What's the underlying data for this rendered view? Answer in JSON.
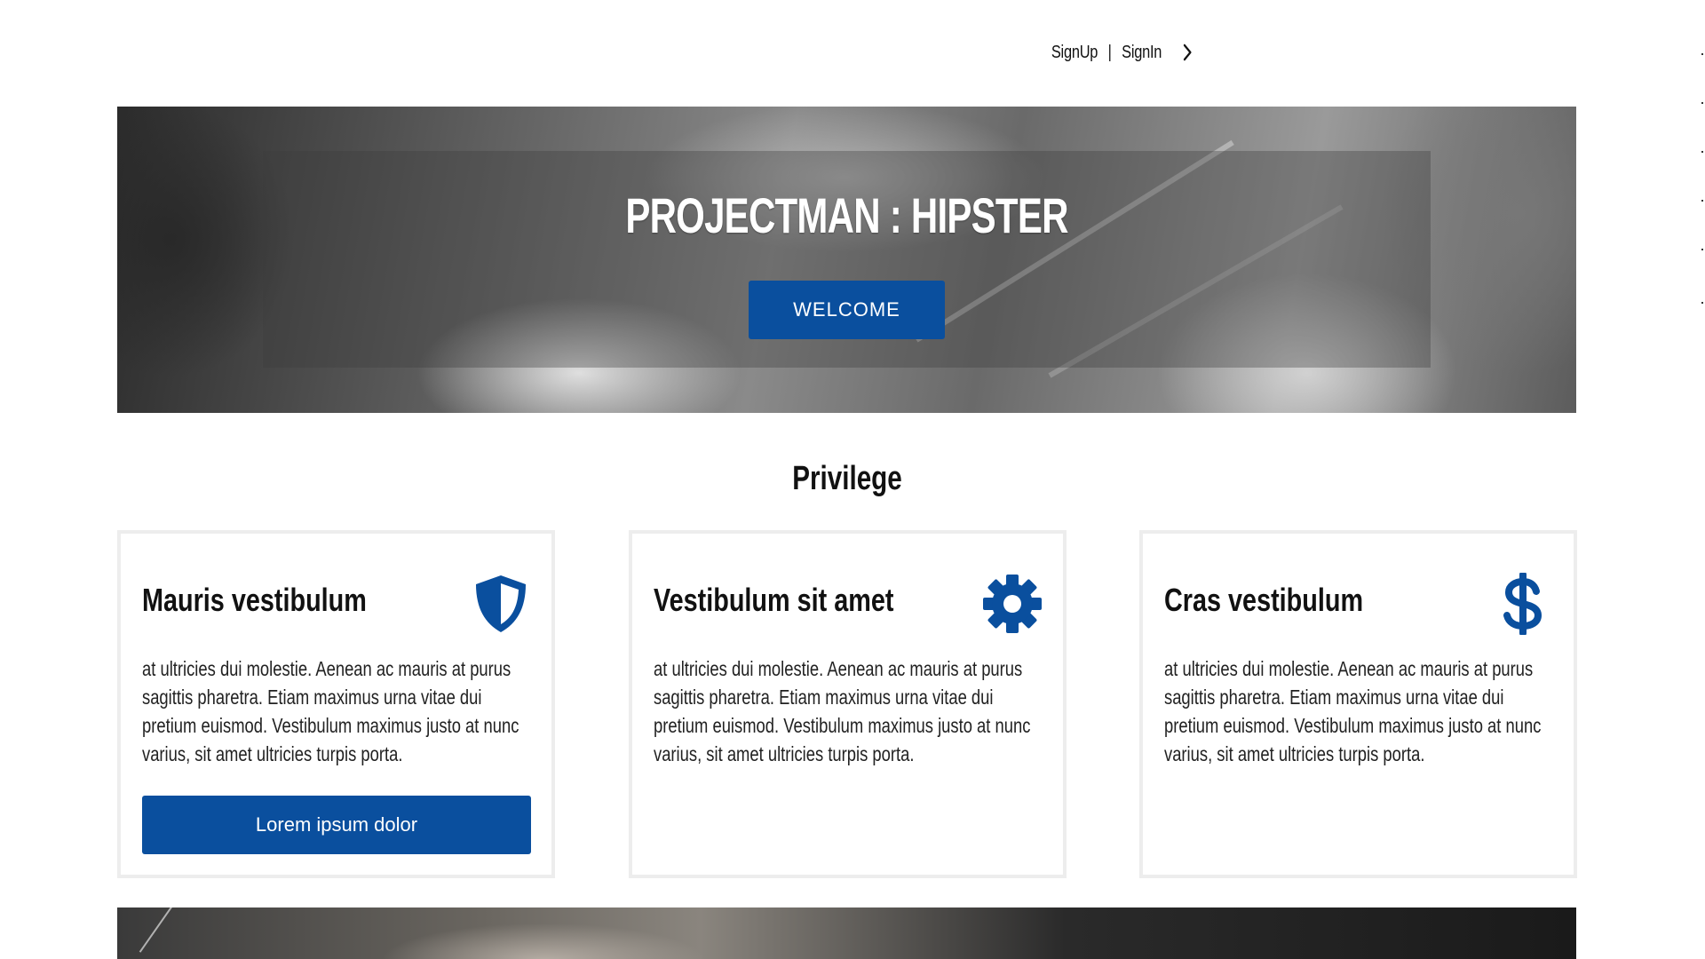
{
  "nav": {
    "signup": "SignUp",
    "separator": "|",
    "signin": "SignIn",
    "chevron_icon": "chevron-right-icon"
  },
  "hero": {
    "title": "PROJECTMAN : HIPSTER",
    "button_label": "WELCOME"
  },
  "section": {
    "title": "Privilege"
  },
  "cards": [
    {
      "title": "Mauris vestibulum",
      "icon": "shield-icon",
      "text": "at ultricies dui molestie. Aenean ac mauris at purus sagittis pharetra. Etiam maximus urna vitae dui pretium euismod. Vestibulum maximus justo at nunc varius, sit amet ultricies turpis porta.",
      "button_label": "Lorem ipsum dolor"
    },
    {
      "title": "Vestibulum sit amet",
      "icon": "gear-icon",
      "text": "at ultricies dui molestie. Aenean ac mauris at purus sagittis pharetra. Etiam maximus urna vitae dui pretium euismod. Vestibulum maximus justo at nunc varius, sit amet ultricies turpis porta."
    },
    {
      "title": "Cras vestibulum",
      "icon": "dollar-icon",
      "text": "at ultricies dui molestie. Aenean ac mauris at purus sagittis pharetra. Etiam maximus urna vitae dui pretium euismod. Vestibulum maximus justo at nunc varius, sit amet ultricies turpis porta."
    }
  ],
  "colors": {
    "accent": "#0a4f9e",
    "card_border": "#ededed",
    "text": "#111111"
  }
}
